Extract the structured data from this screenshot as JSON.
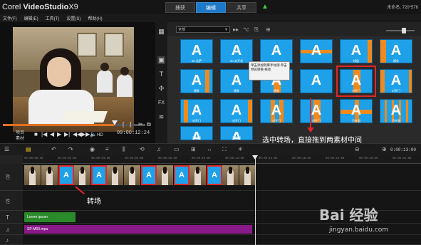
{
  "app": {
    "logo_prefix": "Corel",
    "logo_name": "VideoStudio",
    "logo_suffix": "X9",
    "tabs": [
      "捕获",
      "编辑",
      "共享"
    ],
    "active_tab": "编辑",
    "project_info": "未命名, 720*576"
  },
  "menu": [
    "文件(F)",
    "编辑(E)",
    "工具(T)",
    "设置(S)",
    "帮助(H)"
  ],
  "player": {
    "labels": {
      "project": "项目",
      "clip": "素材"
    },
    "controls": [
      "■",
      "|◀",
      "◀",
      "▶",
      "▶|",
      "◀◀",
      "▶▶",
      "🔈",
      "HD"
    ],
    "mark_icons": [
      "[",
      "]",
      "✂",
      "⧉"
    ],
    "timecode": "00:00:12:24"
  },
  "library": {
    "category": "全部",
    "tools": [
      "▦",
      "▣",
      "T",
      "✣",
      "FX",
      "≋"
    ],
    "top_icons": [
      "▸▸",
      "⌥",
      "⎘",
      "⊕"
    ],
    "tooltip": "单击添加到库手动测 单击预览转换 拖动",
    "thumbs": [
      {
        "cap": "3D 比萨",
        "stripes": "none"
      },
      {
        "cap": "3D 对开发",
        "stripes": "none"
      },
      {
        "cap": "",
        "stripes": "none"
      },
      {
        "cap": "",
        "stripes": "diag"
      },
      {
        "cap": "棋盘",
        "stripes": "right"
      },
      {
        "cap": "横条",
        "stripes": "left"
      },
      {
        "cap": "横条",
        "stripes": "rightv"
      },
      {
        "cap": "横条",
        "stripes": "none"
      },
      {
        "cap": "横条",
        "stripes": "mid"
      },
      {
        "cap": "",
        "stripes": "none"
      },
      {
        "cap": "对开门",
        "stripes": "mid"
      },
      {
        "cap": "对开门",
        "stripes": "sides"
      },
      {
        "cap": "对开门",
        "stripes": "leftv"
      },
      {
        "cap": "对开门",
        "stripes": "right"
      },
      {
        "cap": "对开门",
        "stripes": "wave"
      },
      {
        "cap": "对开门",
        "stripes": "mid"
      },
      {
        "cap": "百叶窗",
        "stripes": "cross"
      },
      {
        "cap": "百叶窗",
        "stripes": "grid"
      },
      {
        "cap": "百叶窗",
        "stripes": "bottom"
      },
      {
        "cap": "百叶窗",
        "stripes": "bottom"
      }
    ],
    "highlight_index": 10,
    "zoom": 0.55
  },
  "annotations": {
    "top": "选中转场，直接拖到两素材中间",
    "bottom": "转场"
  },
  "timeline": {
    "toolbar": [
      "☰",
      "▤",
      "↶",
      "↷",
      "◉",
      "≡",
      "⫼",
      "⟲",
      "♫",
      "▭",
      "⊞",
      "↔",
      "⛶",
      "✳"
    ],
    "zoom_icons": [
      "⊖",
      "⊕"
    ],
    "duration": "0:00:13:00",
    "ruler": [
      "00:00:00:00",
      "00:00:02:00",
      "00:00:04:00",
      "00:00:06:00",
      "00:00:08:00",
      "00:00:10:00",
      "00:00:12:00",
      "00:00:14:00",
      "00:00:16:00",
      "00:00:18:00",
      "00:00:20:00",
      "00:00:22:00"
    ],
    "track_icons": [
      "⎘",
      "⎘",
      "T",
      "♫",
      "♪"
    ],
    "title_clip": "Lorem ipsum",
    "music_clip": "SP-M03.mpa"
  },
  "watermark": {
    "logo": "Bai 经验",
    "url": "jingyan.baidu.com"
  }
}
